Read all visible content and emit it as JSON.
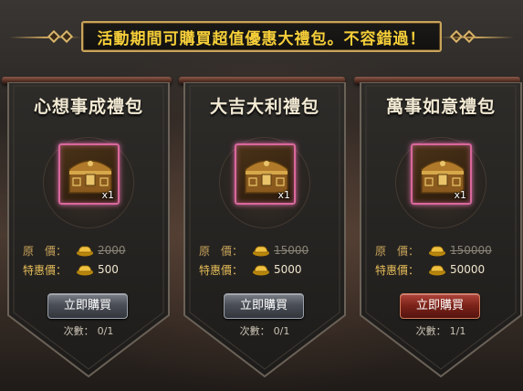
{
  "banner": {
    "text": "活動期間可購買超值優惠大禮包。不容錯過！"
  },
  "colors": {
    "banner_text": "#f7cf39",
    "item_glow": "#e06ba8",
    "price_label": "#c9a45a",
    "buy_button_gray": "#4a4e56",
    "buy_button_red": "#7a2218"
  },
  "packs": [
    {
      "title": "心想事成禮包",
      "item_icon": "treasure-chest-icon",
      "quantity": "x1",
      "original_label": "原　價：",
      "original_price": "2000",
      "special_label": "特惠價：",
      "special_price": "500",
      "button_label": "立即購買",
      "button_style": "gray",
      "count_label": "次數：",
      "count_value": "0/1"
    },
    {
      "title": "大吉大利禮包",
      "item_icon": "treasure-chest-icon",
      "quantity": "x1",
      "original_label": "原　價：",
      "original_price": "15000",
      "special_label": "特惠價：",
      "special_price": "5000",
      "button_label": "立即購買",
      "button_style": "gray",
      "count_label": "次數：",
      "count_value": "0/1"
    },
    {
      "title": "萬事如意禮包",
      "item_icon": "treasure-chest-icon",
      "quantity": "x1",
      "original_label": "原　價：",
      "original_price": "150000",
      "special_label": "特惠價：",
      "special_price": "50000",
      "button_label": "立即購買",
      "button_style": "red",
      "count_label": "次數：",
      "count_value": "1/1"
    }
  ]
}
